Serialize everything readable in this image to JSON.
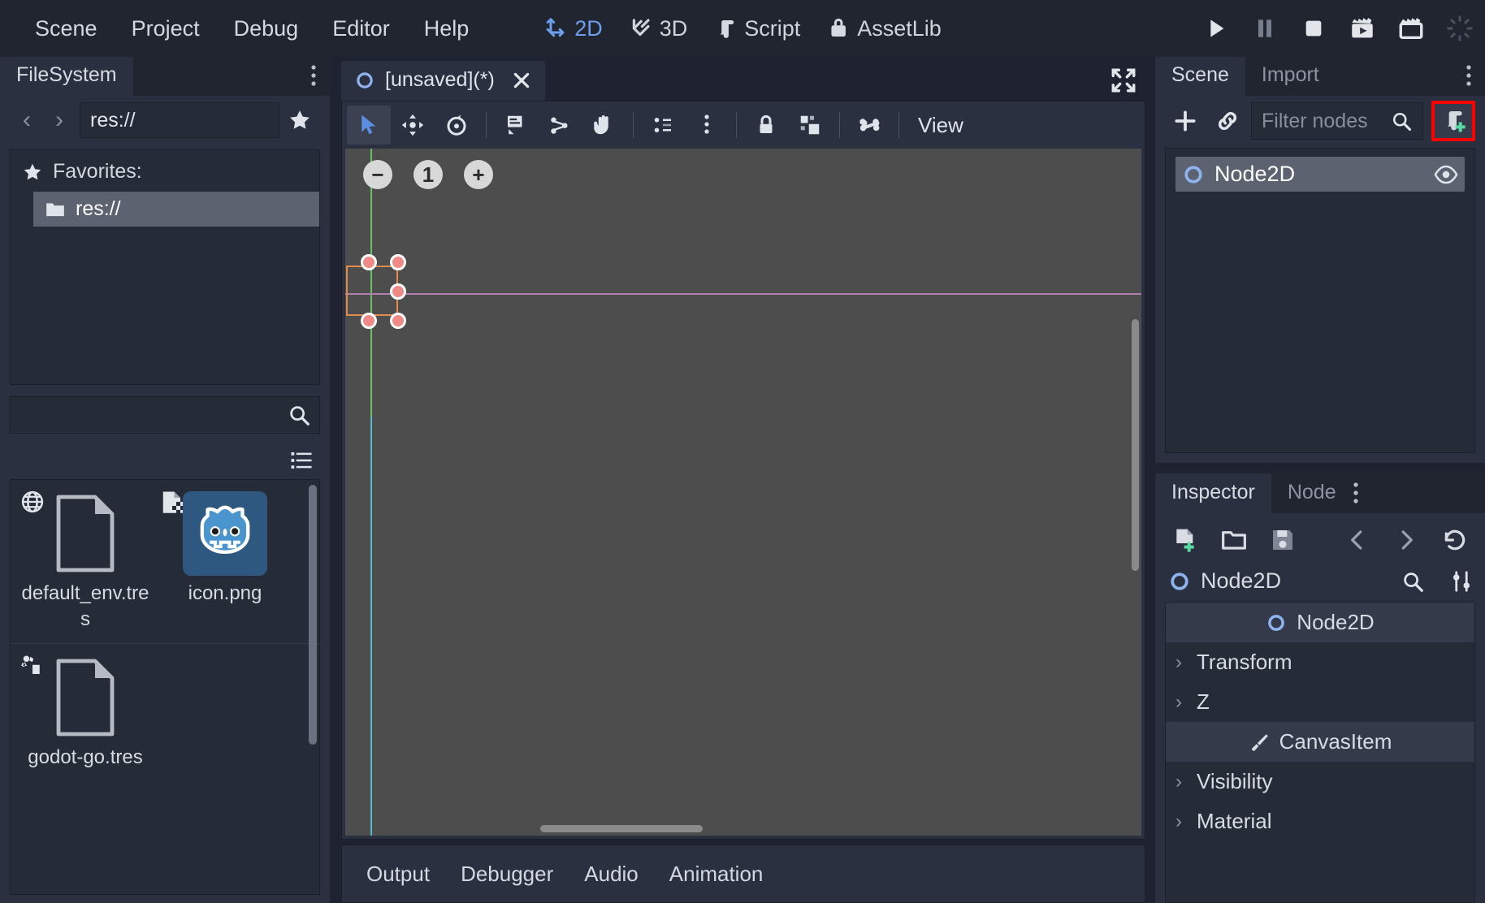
{
  "app": {
    "name": "Godot Engine Editor"
  },
  "menubar": {
    "items": [
      {
        "label": "Scene",
        "name": "menu-scene"
      },
      {
        "label": "Project",
        "name": "menu-project"
      },
      {
        "label": "Debug",
        "name": "menu-debug"
      },
      {
        "label": "Editor",
        "name": "menu-editor"
      },
      {
        "label": "Help",
        "name": "menu-help"
      }
    ],
    "main_modes": [
      {
        "label": "2D",
        "icon": "2d-icon",
        "active": true
      },
      {
        "label": "3D",
        "icon": "3d-icon",
        "active": false
      },
      {
        "label": "Script",
        "icon": "script-icon",
        "active": false
      },
      {
        "label": "AssetLib",
        "icon": "assetlib-icon",
        "active": false
      }
    ],
    "playback": [
      {
        "icon": "play-icon",
        "title": "Play"
      },
      {
        "icon": "pause-icon",
        "title": "Pause"
      },
      {
        "icon": "stop-icon",
        "title": "Stop"
      },
      {
        "icon": "play-scene-icon",
        "title": "Play Scene"
      },
      {
        "icon": "play-custom-scene-icon",
        "title": "Play Custom Scene"
      },
      {
        "icon": "progress-spinner-icon",
        "title": "Progress"
      }
    ],
    "accent_active": "#6d9eeb"
  },
  "filesystem": {
    "tab_label": "FileSystem",
    "menu_icon": "vertical-dots-icon",
    "nav": {
      "back": "‹",
      "forward": "›"
    },
    "path_value": "res://",
    "favorite_icon": "star-icon",
    "favorites_header": "Favorites:",
    "favorites": [
      {
        "label": "res://",
        "icon": "folder-icon",
        "selected": true
      }
    ],
    "search_placeholder": "",
    "search_icon": "search-icon",
    "listmode_icon": "list-view-icon",
    "files": [
      {
        "name": "default_env.tres",
        "thumb": "file-icon",
        "badge": "globe-icon",
        "selected": false
      },
      {
        "name": "icon.png",
        "thumb": "godot-robot-icon",
        "badge": "image-icon",
        "selected": true
      },
      {
        "name": "godot-go.tres",
        "thumb": "file-icon",
        "badge": "script-resource-icon",
        "selected": false
      }
    ]
  },
  "scene_tab": {
    "label": "[unsaved](*)",
    "icon": "node2d-icon",
    "close_icon": "close-icon",
    "distraction_icon": "distraction-free-icon"
  },
  "canvas_toolbar": {
    "tools": [
      {
        "icon": "select-mode-icon",
        "name": "tool-select",
        "active": true
      },
      {
        "icon": "move-mode-icon",
        "name": "tool-move",
        "active": false
      },
      {
        "icon": "rotate-mode-icon",
        "name": "tool-rotate",
        "active": false
      },
      {
        "icon": "ruler-mode-icon",
        "name": "tool-ruler",
        "active": false
      },
      {
        "icon": "pivot-mode-icon",
        "name": "tool-pivot",
        "active": false
      },
      {
        "icon": "pan-mode-icon",
        "name": "tool-pan",
        "active": false
      },
      {
        "icon": "snap-mode-icon",
        "name": "tool-snap",
        "active": false
      },
      {
        "icon": "snap-options-icon",
        "name": "tool-snap-options",
        "active": false
      },
      {
        "icon": "lock-icon",
        "name": "tool-lock",
        "active": false
      },
      {
        "icon": "group-icon",
        "name": "tool-group",
        "active": false
      },
      {
        "icon": "bone-icon",
        "name": "tool-skeleton",
        "active": false
      }
    ],
    "view_label": "View"
  },
  "viewport": {
    "zoom_out_label": "−",
    "zoom_level_label": "1",
    "zoom_in_label": "+",
    "selection_color": "#e08b4e",
    "handle_color": "#f08a86",
    "x_axis_color": "#b07fb0",
    "y_axis_color": "#6bbf6b",
    "background": "#4d4d4d"
  },
  "bottom_dock": {
    "tabs": [
      {
        "label": "Output",
        "name": "bottom-tab-output"
      },
      {
        "label": "Debugger",
        "name": "bottom-tab-debugger"
      },
      {
        "label": "Audio",
        "name": "bottom-tab-audio"
      },
      {
        "label": "Animation",
        "name": "bottom-tab-animation"
      }
    ]
  },
  "scene_dock": {
    "tabs": [
      {
        "label": "Scene",
        "active": true
      },
      {
        "label": "Import",
        "active": false
      }
    ],
    "menu_icon": "vertical-dots-icon",
    "add_node_icon": "plus-icon",
    "instance_icon": "link-icon",
    "filter_placeholder": "Filter nodes",
    "filter_value": "",
    "search_icon": "search-icon",
    "attach_script": {
      "icon": "attach-script-icon",
      "highlight_color": "#ff0000",
      "highlighted": true
    },
    "tree": [
      {
        "label": "Node2D",
        "icon": "node2d-icon",
        "selected": true,
        "visibility_icon": "eye-icon"
      }
    ]
  },
  "inspector": {
    "tabs": [
      {
        "label": "Inspector",
        "active": true
      },
      {
        "label": "Node",
        "active": false
      }
    ],
    "menu_icon": "vertical-dots-icon",
    "toolbar": [
      {
        "icon": "new-resource-icon",
        "name": "new-resource-button"
      },
      {
        "icon": "open-resource-icon",
        "name": "load-resource-button"
      },
      {
        "icon": "save-resource-icon",
        "name": "save-resource-button"
      },
      {
        "icon": "history-back-icon",
        "name": "history-back-button"
      },
      {
        "icon": "history-forward-icon",
        "name": "history-forward-button"
      },
      {
        "icon": "history-icon",
        "name": "history-button"
      }
    ],
    "object_label": "Node2D",
    "object_icon": "node2d-icon",
    "search_icon": "search-icon",
    "tools_icon": "object-tools-icon",
    "properties": [
      {
        "label": "Node2D",
        "kind": "category",
        "icon": "node2d-icon"
      },
      {
        "label": "Transform",
        "kind": "section",
        "expanded": false
      },
      {
        "label": "Z",
        "kind": "section",
        "expanded": false
      },
      {
        "label": "CanvasItem",
        "kind": "category",
        "icon": "canvasitem-brush-icon"
      },
      {
        "label": "Visibility",
        "kind": "section",
        "expanded": false
      },
      {
        "label": "Material",
        "kind": "section",
        "expanded": false
      }
    ]
  }
}
